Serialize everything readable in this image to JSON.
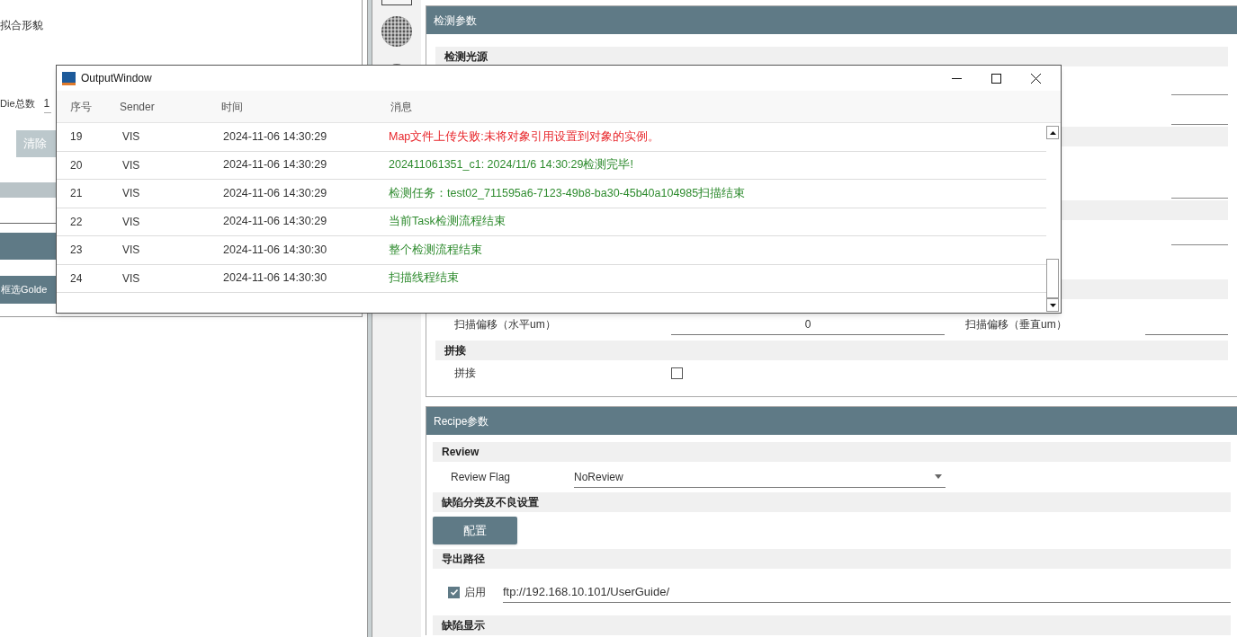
{
  "left_panel": {
    "shape_label": "拟合形貌",
    "die_count": {
      "label": "Die总数",
      "value": "1"
    },
    "clear_button": {
      "label": "清除",
      "disabled": true
    },
    "golden_button": "框选Golde"
  },
  "detection_panel": {
    "title": "检测参数",
    "light_source_section": "检测光源",
    "scan_offset_h": {
      "label": "扫描偏移（水平um）",
      "value": "0"
    },
    "scan_offset_v": {
      "label": "扫描偏移（垂直um）"
    },
    "stitch_section": "拼接",
    "stitch": {
      "label": "拼接",
      "checked": false
    }
  },
  "recipe_panel": {
    "title": "Recipe参数",
    "review_section": "Review",
    "review_flag": {
      "label": "Review Flag",
      "value": "NoReview"
    },
    "defect_section": "缺陷分类及不良设置",
    "config_button": "配置",
    "export_section": "导出路径",
    "export_enabled": {
      "label": "启用",
      "checked": true
    },
    "export_path": "ftp://192.168.10.101/UserGuide/",
    "defect_display_section": "缺陷显示"
  },
  "output_window": {
    "title": "OutputWindow",
    "columns": [
      "序号",
      "Sender",
      "时间",
      "消息"
    ],
    "rows": [
      {
        "index": "19",
        "sender": "VIS",
        "time": "2024-11-06 14:30:29",
        "message": "Map文件上传失败:未将对象引用设置到对象的实例。",
        "color": "#e8262b"
      },
      {
        "index": "20",
        "sender": "VIS",
        "time": "2024-11-06 14:30:29",
        "message": "202411061351_c1: 2024/11/6 14:30:29检测完毕!",
        "color": "#2e8b2e"
      },
      {
        "index": "21",
        "sender": "VIS",
        "time": "2024-11-06 14:30:29",
        "message": "检测任务：test02_711595a6-7123-49b8-ba30-45b40a104985扫描结束",
        "color": "#2e8b2e"
      },
      {
        "index": "22",
        "sender": "VIS",
        "time": "2024-11-06 14:30:29",
        "message": "当前Task检测流程结束",
        "color": "#2e8b2e"
      },
      {
        "index": "23",
        "sender": "VIS",
        "time": "2024-11-06 14:30:30",
        "message": "整个检测流程结束",
        "color": "#2e8b2e"
      },
      {
        "index": "24",
        "sender": "VIS",
        "time": "2024-11-06 14:30:30",
        "message": "扫描线程结束",
        "color": "#2e8b2e"
      }
    ]
  }
}
